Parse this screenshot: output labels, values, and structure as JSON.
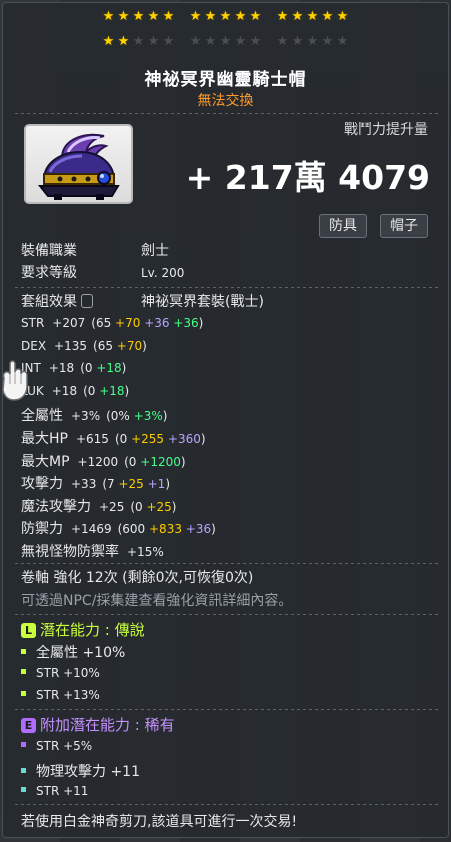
{
  "stars": [
    [
      1,
      1,
      1,
      1,
      1
    ],
    [
      1,
      1,
      1,
      1,
      1
    ],
    [
      1,
      1,
      1,
      1,
      1
    ],
    [
      1,
      1,
      0,
      0,
      0
    ],
    [
      0,
      0,
      0,
      0,
      0
    ],
    [
      0,
      0,
      0,
      0,
      0
    ]
  ],
  "item": {
    "name": "神祕冥界幽靈騎士帽",
    "trade": "無法交換",
    "icon": "helmet-icon"
  },
  "combat_power": {
    "label": "戰鬥力提升量",
    "value": "+ 217萬 4079"
  },
  "tags": [
    "防具",
    "帽子"
  ],
  "info": {
    "job_label": "裝備職業",
    "job_value": "劍士",
    "level_label": "要求等級",
    "level_value": "Lv. 200"
  },
  "set": {
    "label": "套組效果",
    "value": "神祕冥界套裝(戰士)"
  },
  "stats": [
    {
      "label": "STR",
      "total": "+207",
      "parts": [
        [
          "(65 ",
          ""
        ],
        [
          "+70",
          "y"
        ],
        [
          " ",
          ""
        ],
        [
          "+36",
          "p"
        ],
        [
          " ",
          ""
        ],
        [
          "+36",
          "g"
        ],
        [
          ")",
          ""
        ]
      ]
    },
    {
      "label": "DEX",
      "total": "+135",
      "parts": [
        [
          "(65 ",
          ""
        ],
        [
          "+70",
          "y"
        ],
        [
          ")",
          ""
        ]
      ]
    },
    {
      "label": "INT",
      "total": "+18",
      "parts": [
        [
          "(0 ",
          ""
        ],
        [
          "+18",
          "g"
        ],
        [
          ")",
          ""
        ]
      ]
    },
    {
      "label": "LUK",
      "total": "+18",
      "parts": [
        [
          "(0 ",
          ""
        ],
        [
          "+18",
          "g"
        ],
        [
          ")",
          ""
        ]
      ]
    },
    {
      "label": "全屬性",
      "total": "+3%",
      "parts": [
        [
          "(0% ",
          ""
        ],
        [
          "+3%",
          "g"
        ],
        [
          ")",
          ""
        ]
      ]
    },
    {
      "label": "最大HP",
      "total": "+615",
      "parts": [
        [
          "(0 ",
          ""
        ],
        [
          "+255",
          "y"
        ],
        [
          " ",
          ""
        ],
        [
          "+360",
          "p"
        ],
        [
          ")",
          ""
        ]
      ]
    },
    {
      "label": "最大MP",
      "total": "+1200",
      "parts": [
        [
          "(0 ",
          ""
        ],
        [
          "+1200",
          "g"
        ],
        [
          ")",
          ""
        ]
      ]
    },
    {
      "label": "攻擊力",
      "total": "+33",
      "parts": [
        [
          "(7 ",
          ""
        ],
        [
          "+25",
          "y"
        ],
        [
          " ",
          ""
        ],
        [
          "+1",
          "p"
        ],
        [
          ")",
          ""
        ]
      ]
    },
    {
      "label": "魔法攻擊力",
      "total": "+25",
      "parts": [
        [
          "(0 ",
          ""
        ],
        [
          "+25",
          "y"
        ],
        [
          ")",
          ""
        ]
      ]
    },
    {
      "label": "防禦力",
      "total": "+1469",
      "parts": [
        [
          "(600 ",
          ""
        ],
        [
          "+833",
          "y"
        ],
        [
          " ",
          ""
        ],
        [
          "+36",
          "p"
        ],
        [
          ")",
          ""
        ]
      ]
    },
    {
      "label": "無視怪物防禦率",
      "total": "+15%",
      "parts": []
    }
  ],
  "scroll": {
    "text": "卷軸 強化 12次 (剩餘0次,可恢復0次)",
    "hint": "可透過NPC/採集建查看強化資訊詳細內容。"
  },
  "potential": {
    "badge": "L",
    "badge_color": "#c8ff3c",
    "title": "潛在能力",
    "grade": "傳說",
    "title_color": "#c8ff3c",
    "lines": [
      "全屬性 +10%",
      "STR +10%",
      "STR +13%"
    ]
  },
  "bonus_potential": {
    "badge": "E",
    "badge_color": "#b06cff",
    "title": "附加潛在能力",
    "grade": "稀有",
    "title_color": "#c490ff",
    "lines": [
      "STR +5%",
      "物理攻擊力 +11",
      "STR +11"
    ],
    "bullet_colors": [
      "#b06cff",
      "#66ddcc",
      "#66ddcc"
    ]
  },
  "footer": "若使用白金神奇剪刀,該道具可進行一次交易!"
}
